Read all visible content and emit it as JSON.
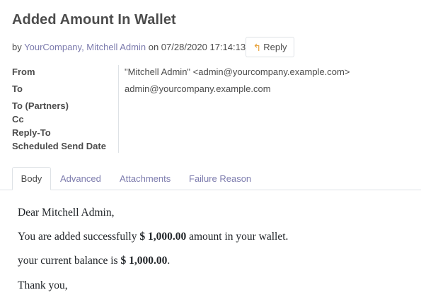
{
  "header": {
    "title": "Added Amount In Wallet",
    "by_prefix": "by",
    "author": "YourCompany, Mitchell Admin",
    "on_text": "on 07/28/2020 17:14:13",
    "reply_label": "Reply",
    "reply_icon": "reply-arrow-icon",
    "reply_icon_color": "#e8a33d"
  },
  "fields": {
    "from_label": "From",
    "from_value": "\"Mitchell Admin\" <admin@yourcompany.example.com>",
    "to_label": "To",
    "to_value": "admin@yourcompany.example.com",
    "to_partners_label": "To (Partners)",
    "cc_label": "Cc",
    "reply_to_label": "Reply-To",
    "scheduled_label": "Scheduled Send Date"
  },
  "tabs": [
    {
      "label": "Body",
      "active": true
    },
    {
      "label": "Advanced",
      "active": false
    },
    {
      "label": "Attachments",
      "active": false
    },
    {
      "label": "Failure Reason",
      "active": false
    }
  ],
  "body": {
    "greeting": "Dear Mitchell Admin,",
    "line1_pre": "You are added successfully",
    "line1_amount": "$ 1,000.00",
    "line1_post": "amount in your wallet.",
    "line2_pre": "your current balance is",
    "line2_amount": "$ 1,000.00",
    "line2_post": ".",
    "closing": "Thank you,"
  },
  "colors": {
    "link": "#7c7bad",
    "text": "#4c4c4c",
    "border": "#dee2e6"
  }
}
